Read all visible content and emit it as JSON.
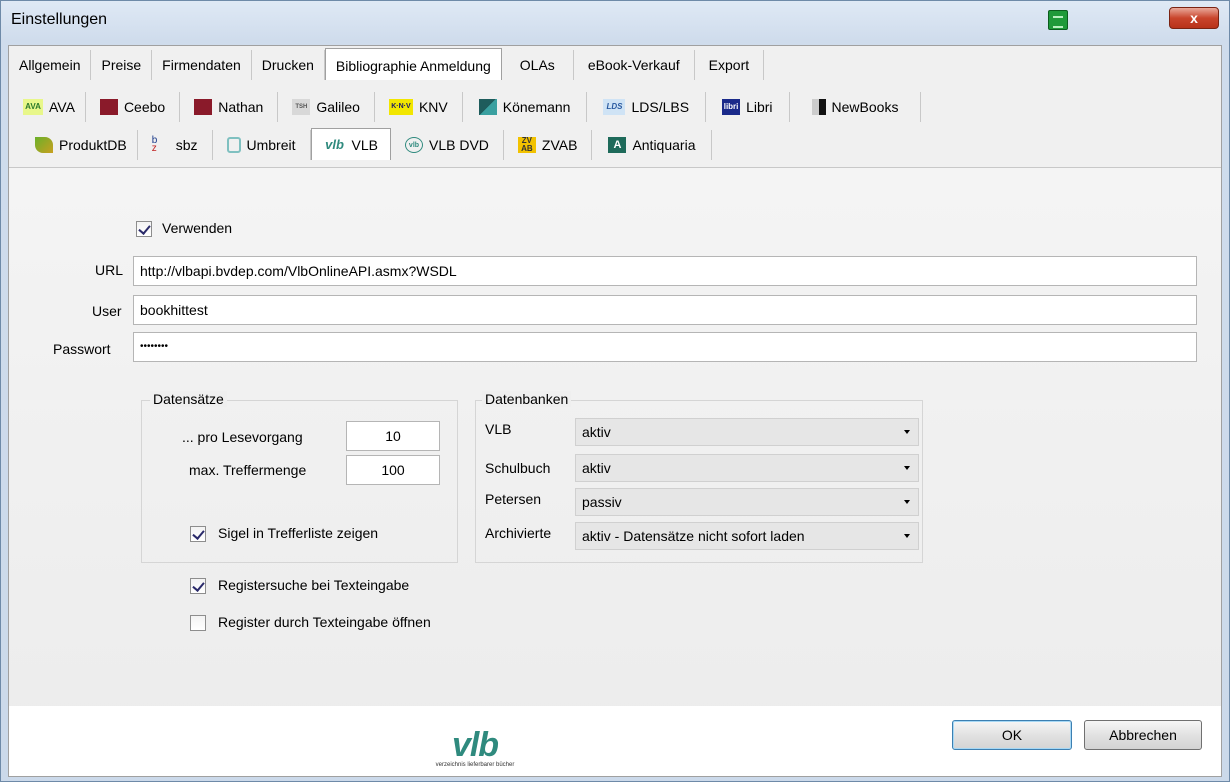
{
  "window": {
    "title": "Einstellungen",
    "close_label": "x"
  },
  "main_tabs": [
    {
      "label": "Allgemein"
    },
    {
      "label": "Preise"
    },
    {
      "label": "Firmendaten"
    },
    {
      "label": "Drucken"
    },
    {
      "label": "Bibliographie Anmeldung",
      "selected": true
    },
    {
      "label": "OLAs"
    },
    {
      "label": "eBook-Verkauf"
    },
    {
      "label": "Export"
    }
  ],
  "provider_tabs_row1": [
    {
      "label": "AVA",
      "icon": "ava-icon"
    },
    {
      "label": "Ceebo",
      "icon": "ceebo-icon"
    },
    {
      "label": "Nathan",
      "icon": "nathan-icon"
    },
    {
      "label": "Galileo",
      "icon": "galileo-icon"
    },
    {
      "label": "KNV",
      "icon": "knv-icon"
    },
    {
      "label": "Könemann",
      "icon": "koenemann-icon"
    },
    {
      "label": "LDS/LBS",
      "icon": "lds-icon"
    },
    {
      "label": "Libri",
      "icon": "libri-icon"
    },
    {
      "label": "NewBooks",
      "icon": "newbooks-icon"
    }
  ],
  "provider_tabs_row2": [
    {
      "label": "ProduktDB",
      "icon": "produktdb-icon"
    },
    {
      "label": "sbz",
      "icon": "sbz-icon"
    },
    {
      "label": "Umbreit",
      "icon": "umbreit-icon"
    },
    {
      "label": "VLB",
      "icon": "vlb-icon",
      "selected": true
    },
    {
      "label": "VLB DVD",
      "icon": "vlb-dvd-icon"
    },
    {
      "label": "ZVAB",
      "icon": "zvab-icon"
    },
    {
      "label": "Antiquaria",
      "icon": "antiquaria-icon"
    }
  ],
  "icon_text": {
    "ava": "AVA",
    "knv": "K·N·V",
    "lds": "LDS",
    "libri": "libri",
    "vlb": "vlb",
    "vlbdvd": "vlb",
    "zvab_top": "ZV",
    "zvab_bottom": "AB",
    "antiquaria": "A",
    "galileo": "TSH",
    "sbz_top": "b",
    "sbz_bottom": "z"
  },
  "form": {
    "use_label": "Verwenden",
    "use_checked": true,
    "url_label": "URL",
    "url_value": "http://vlbapi.bvdep.com/VlbOnlineAPI.asmx?WSDL",
    "user_label": "User",
    "user_value": "bookhittest",
    "password_label": "Passwort",
    "password_value": "••••••••"
  },
  "datensaetze": {
    "title": "Datensätze",
    "per_read_label": "... pro Lesevorgang",
    "per_read_value": "10",
    "max_hits_label": "max. Treffermenge",
    "max_hits_value": "100",
    "sigel_label": "Sigel in Trefferliste zeigen",
    "sigel_checked": true
  },
  "datenbanken": {
    "title": "Datenbanken",
    "rows": [
      {
        "label": "VLB",
        "value": "aktiv"
      },
      {
        "label": "Schulbuch",
        "value": "aktiv"
      },
      {
        "label": "Petersen",
        "value": "passiv"
      },
      {
        "label": "Archivierte",
        "value": "aktiv - Datensätze nicht sofort laden"
      }
    ]
  },
  "options": {
    "register_search_label": "Registersuche bei Texteingabe",
    "register_search_checked": true,
    "register_open_label": "Register durch Texteingabe öffnen",
    "register_open_checked": false
  },
  "logo": {
    "word": "vlb",
    "subtitle": "verzeichnis lieferbarer bücher"
  },
  "buttons": {
    "ok": "OK",
    "cancel": "Abbrechen"
  },
  "colors": {
    "accent_green": "#2f8a7e",
    "close_red": "#c9452c",
    "tray_green": "#1f9a3a"
  }
}
